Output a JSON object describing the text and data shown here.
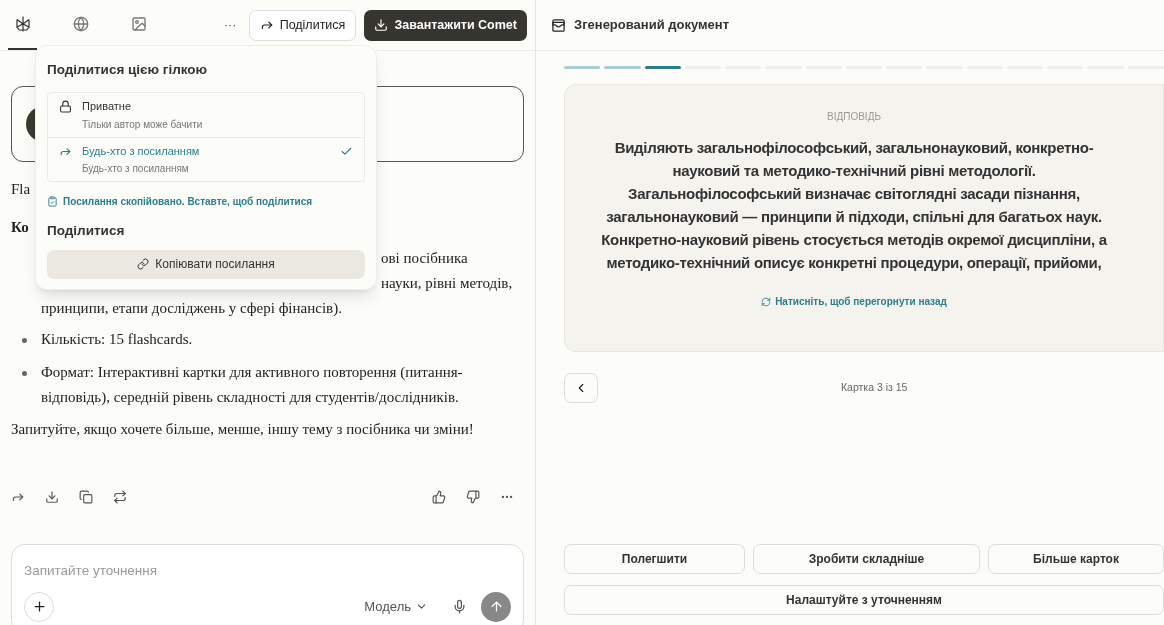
{
  "top_bar": {
    "tabs": [
      {
        "selected": true
      },
      {
        "selected": false
      },
      {
        "selected": false
      }
    ],
    "more": "···",
    "share_button": "Поділитися",
    "download_button": "Завантажити Comet"
  },
  "chat": {
    "fragments": {
      "card_text": "Fla",
      "heading": "Ко",
      "bullet1_lines": [
        "ові посібника",
        "науки, рівні методів,",
        "принципи, етапи досліджень у сфері фінансів)."
      ]
    },
    "bullets": [
      "Кількість: 15 flashcards.",
      "Формат: Інтерактивні картки для активного повторення (питання-відповідь), середній рівень складності для студентів/дослідників."
    ],
    "closing": "Запитуйте, якщо хочете більше, менше, іншу тему з посібника чи зміни!",
    "input": {
      "placeholder": "Запитайте уточнення",
      "model": "Модель"
    }
  },
  "share_popover": {
    "title": "Поділитися цією гілкою",
    "options": [
      {
        "label": "Приватне",
        "description": "Тільки автор може бачити",
        "selected": false
      },
      {
        "label": "Будь-хто з посиланням",
        "description": "Будь-хто з посиланням",
        "selected": true
      }
    ],
    "copied_notice": "Посилання скопійовано. Вставте, щоб поділитися",
    "share_heading": "Поділитися",
    "copy_button": "Копіювати посилання"
  },
  "document": {
    "title": "Згенерований документ",
    "progress": [
      {
        "completed": true,
        "current": false
      },
      {
        "completed": true,
        "current": false
      },
      {
        "completed": true,
        "current": true
      },
      {
        "completed": false,
        "current": false
      },
      {
        "completed": false,
        "current": false
      },
      {
        "completed": false,
        "current": false
      },
      {
        "completed": false,
        "current": false
      },
      {
        "completed": false,
        "current": false
      },
      {
        "completed": false,
        "current": false
      },
      {
        "completed": false,
        "current": false
      },
      {
        "completed": false,
        "current": false
      },
      {
        "completed": false,
        "current": false
      },
      {
        "completed": false,
        "current": false
      },
      {
        "completed": false,
        "current": false
      },
      {
        "completed": false,
        "current": false
      }
    ],
    "card": {
      "side_label": "ВІДПОВІДЬ",
      "text": "Виділяють загальнофілософський, загальнонауковий, конкретно-науковий та методико-технічний рівні методології. Загальнофілософський визначає світоглядні засади пізнання, загальнонауковий — принципи й підходи, спільні для багатьох наук. Конкретно-науковий рівень стосується методів окремої дисципліни, а методико-технічний описує конкретні процедури, операції, прийоми,",
      "flip_hint": "Натисніть, щоб перегорнути назад"
    },
    "counter": "Картка 3 із 15",
    "actions": [
      "Полегшити",
      "Зробити складніше",
      "Більше карток"
    ],
    "refine_button": "Налаштуйте з уточненням"
  }
}
